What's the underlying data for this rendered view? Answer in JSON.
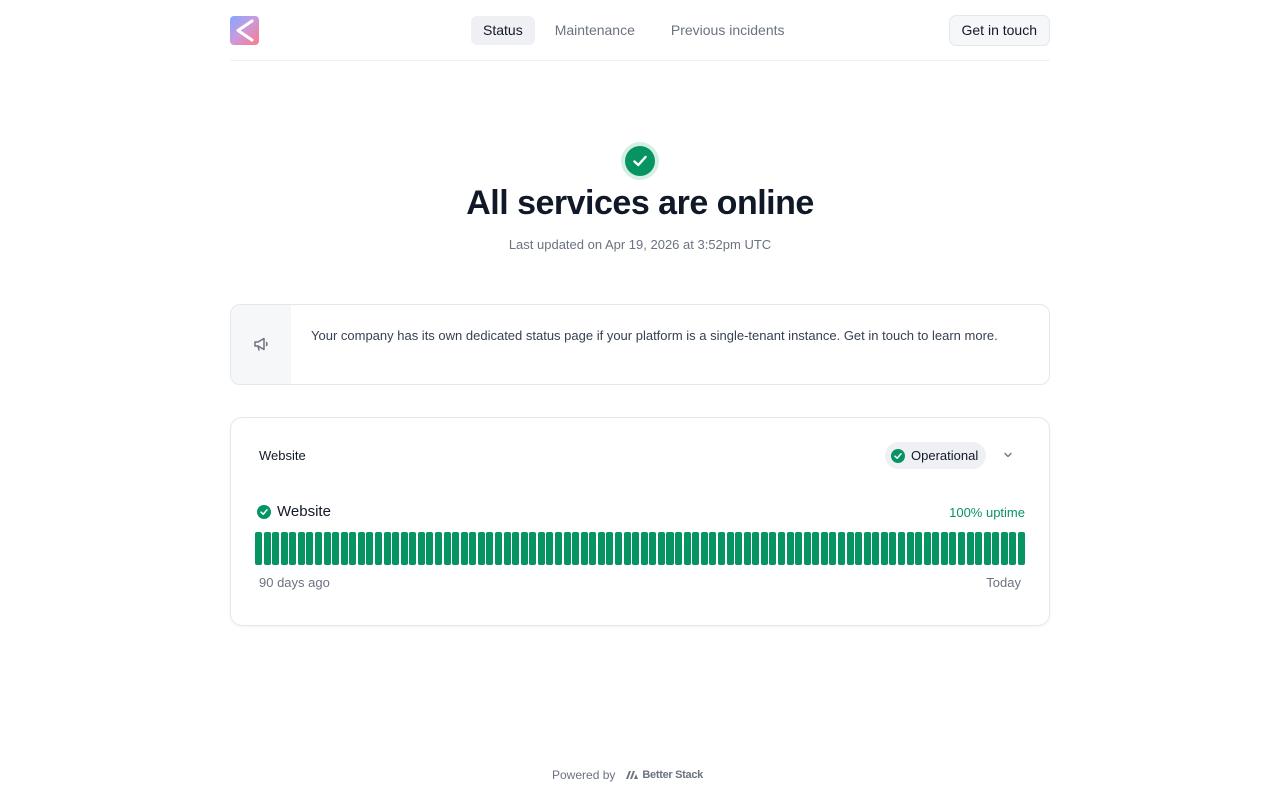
{
  "header": {
    "logo_icon": "company-logo",
    "nav": [
      {
        "label": "Status",
        "active": true
      },
      {
        "label": "Maintenance",
        "active": false
      },
      {
        "label": "Previous incidents",
        "active": false
      }
    ],
    "contact_label": "Get in touch"
  },
  "hero": {
    "icon": "check-circle-icon",
    "title": "All services are online",
    "subtitle": "Last updated on Apr 19, 2026 at 3:52pm UTC"
  },
  "notice": {
    "icon": "megaphone-icon",
    "text": "Your company has its own dedicated status page if your platform is a single-tenant instance. Get in touch to learn more."
  },
  "group": {
    "title": "Website",
    "status": "Operational",
    "status_color": "#079463",
    "services": [
      {
        "name": "Website",
        "uptime": "100% uptime",
        "bar_count": 90,
        "bar_color": "#079463"
      }
    ],
    "range_start": "90 days ago",
    "range_end": "Today"
  },
  "footer": {
    "powered_by": "Powered by",
    "brand": "Better Stack"
  }
}
